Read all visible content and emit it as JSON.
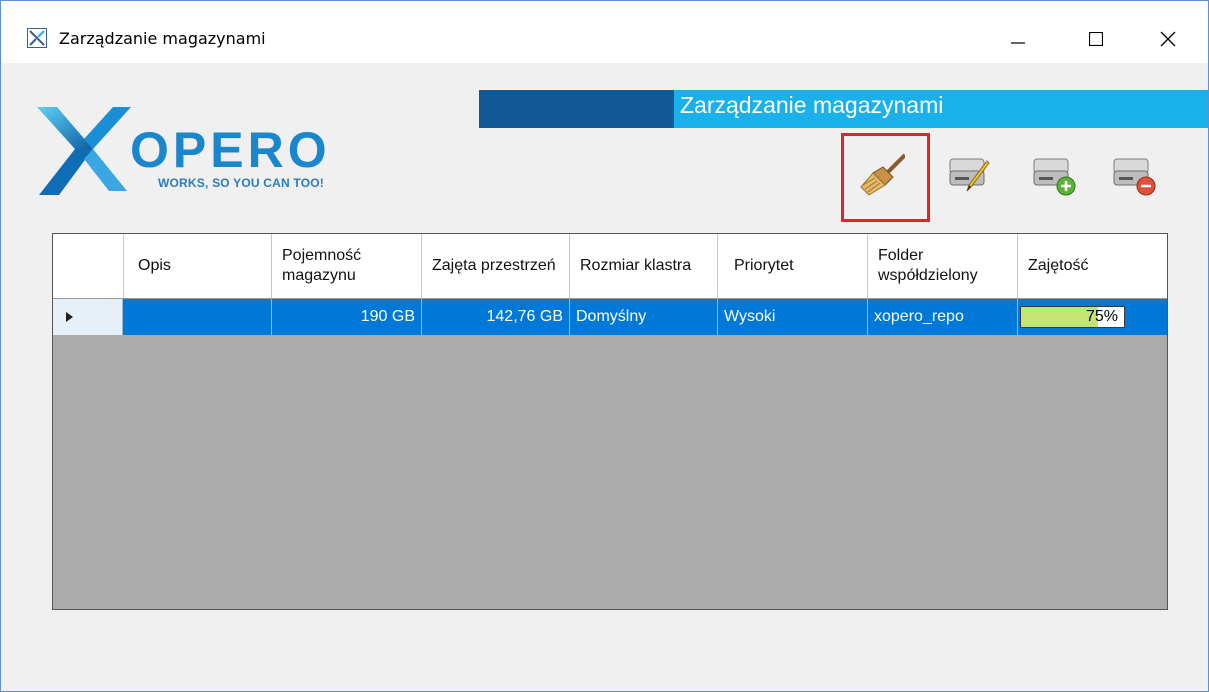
{
  "window": {
    "title": "Zarządzanie magazynami",
    "controls": [
      "minimize-icon",
      "maximize-icon",
      "close-icon"
    ]
  },
  "logo": {
    "brand": "XOPERO",
    "tagline": "WORKS, SO YOU CAN TOO!"
  },
  "banner": {
    "title": "Zarządzanie magazynami"
  },
  "toolbar": {
    "buttons": [
      "broom-icon",
      "edit-drive-icon",
      "add-drive-icon",
      "remove-drive-icon"
    ],
    "highlighted": "broom-icon"
  },
  "table": {
    "columns": [
      "Opis",
      "Pojemność magazynu",
      "Zajęta przestrzeń",
      "Rozmiar klastra",
      "Priorytet",
      "Folder współdzielony",
      "Zajętość"
    ],
    "rows": [
      {
        "opis": "",
        "pojemnosc": "190 GB",
        "zajeta": "142,76 GB",
        "klaster": "Domyślny",
        "priorytet": "Wysoki",
        "folder": "xopero_repo",
        "zajetosc": "75%",
        "zajetosc_fraction": 0.75
      }
    ]
  },
  "colors": {
    "selection": "#0078d7",
    "banner_dark": "#0f5a96",
    "banner_light": "#1ab0ec",
    "highlight": "#e3232a",
    "usage_fill": "#c2e671"
  }
}
